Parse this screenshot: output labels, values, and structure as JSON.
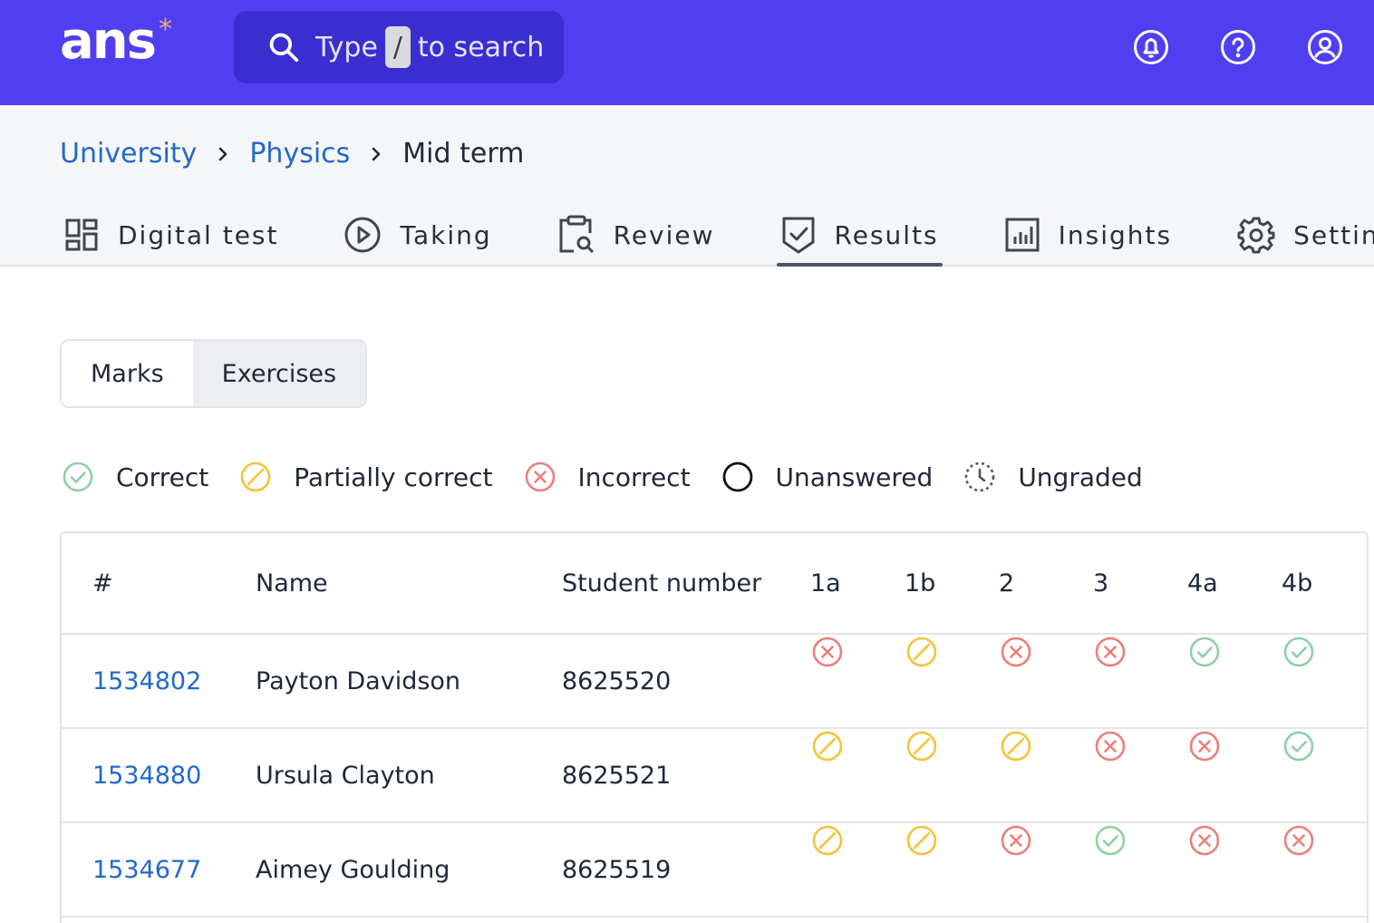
{
  "app": {
    "logo": "ans",
    "logo_mark": "*"
  },
  "search": {
    "prefix": "Type",
    "key": "/",
    "suffix": "to search"
  },
  "top_icons": [
    "bell-icon",
    "help-icon",
    "user-icon"
  ],
  "breadcrumb": {
    "items": [
      "University",
      "Physics"
    ],
    "current": "Mid term"
  },
  "tabs": [
    {
      "label": "Digital test",
      "icon": "grid-icon"
    },
    {
      "label": "Taking",
      "icon": "play-circle-icon"
    },
    {
      "label": "Review",
      "icon": "clipboard-search-icon"
    },
    {
      "label": "Results",
      "icon": "shield-check-icon",
      "active": true
    },
    {
      "label": "Insights",
      "icon": "bar-chart-icon"
    },
    {
      "label": "Settings",
      "icon": "gear-icon"
    }
  ],
  "view_toggle": {
    "options": [
      "Marks",
      "Exercises"
    ],
    "selected": "Exercises"
  },
  "legend": [
    {
      "label": "Correct",
      "status": "correct"
    },
    {
      "label": "Partially correct",
      "status": "partial"
    },
    {
      "label": "Incorrect",
      "status": "incorrect"
    },
    {
      "label": "Unanswered",
      "status": "unanswered"
    },
    {
      "label": "Ungraded",
      "status": "ungraded"
    }
  ],
  "table": {
    "columns": [
      "#",
      "Name",
      "Student number",
      "1a",
      "1b",
      "2",
      "3",
      "4a",
      "4b"
    ],
    "rows": [
      {
        "id": "1534802",
        "name": "Payton Davidson",
        "student_number": "8625520",
        "results": [
          "incorrect",
          "partial",
          "incorrect",
          "incorrect",
          "correct",
          "correct"
        ]
      },
      {
        "id": "1534880",
        "name": "Ursula Clayton",
        "student_number": "8625521",
        "results": [
          "partial",
          "partial",
          "partial",
          "incorrect",
          "incorrect",
          "correct"
        ]
      },
      {
        "id": "1534677",
        "name": "Aimey Goulding",
        "student_number": "8625519",
        "results": [
          "partial",
          "partial",
          "incorrect",
          "correct",
          "incorrect",
          "incorrect"
        ]
      }
    ]
  },
  "colors": {
    "brand": "#4f3ff0",
    "link": "#2368c9",
    "correct": "#8fd0a4",
    "partial": "#f2c438",
    "incorrect": "#ec7f7a",
    "unanswered": "#111111",
    "ungraded": "#4b5563"
  }
}
